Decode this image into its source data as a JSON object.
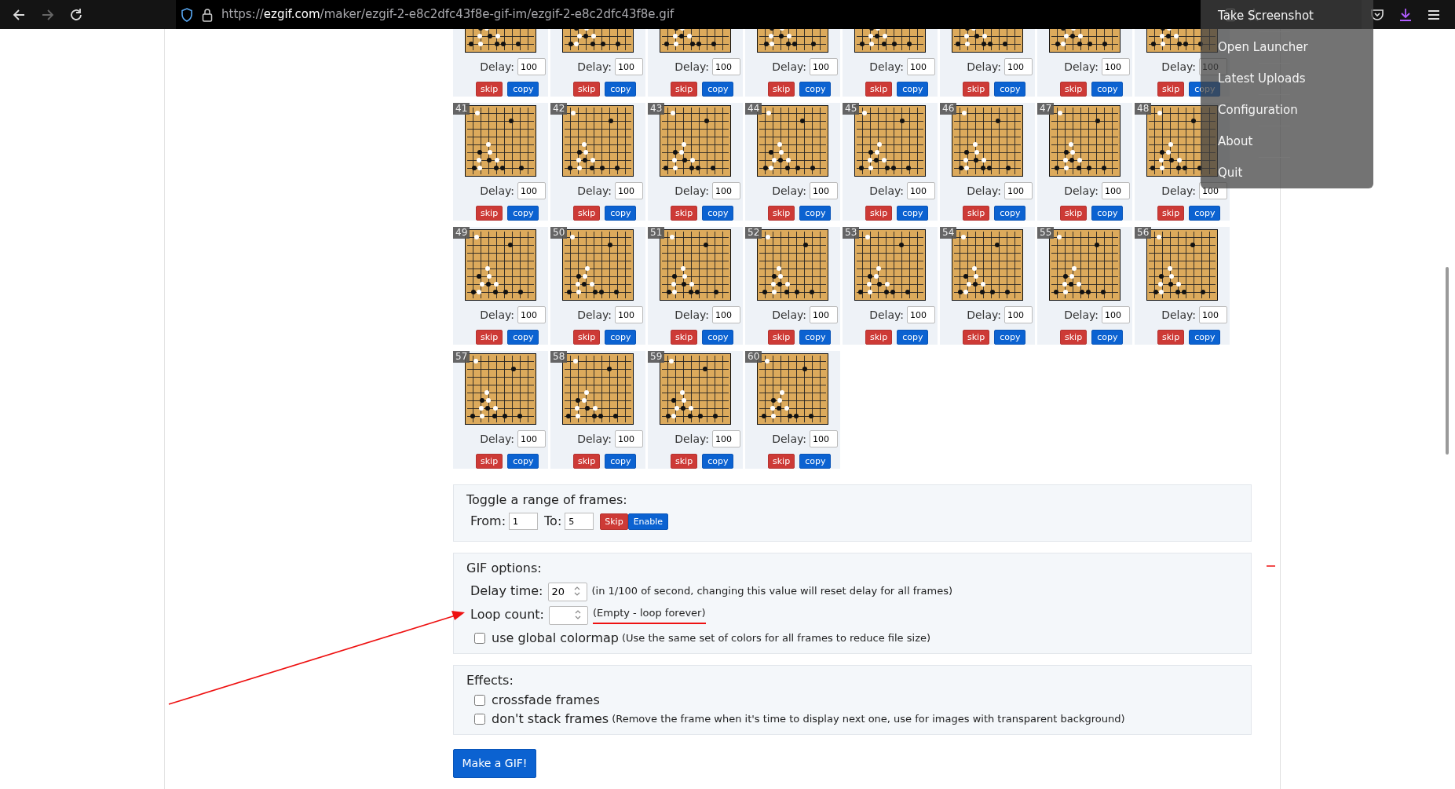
{
  "browser": {
    "url": "https://**ezgif.com**/maker/ezgif-2-e8c2dfc43f8e-gif-im/ezgif-2-e8c2dfc43f8e.gif"
  },
  "menu": {
    "items": [
      "Take Screenshot",
      "Open Launcher",
      "Latest Uploads",
      "Configuration",
      "About",
      "Quit"
    ]
  },
  "frames": [
    {
      "delay_label": "Delay:",
      "delay": "100",
      "skip": "skip",
      "copy": "copy"
    },
    {
      "delay_label": "Delay:",
      "delay": "100",
      "skip": "skip",
      "copy": "copy"
    },
    {
      "delay_label": "Delay:",
      "delay": "100",
      "skip": "skip",
      "copy": "copy"
    },
    {
      "delay_label": "Delay:",
      "delay": "100",
      "skip": "skip",
      "copy": "copy"
    },
    {
      "delay_label": "Delay:",
      "delay": "100",
      "skip": "skip",
      "copy": "copy"
    },
    {
      "delay_label": "Delay:",
      "delay": "100",
      "skip": "skip",
      "copy": "copy"
    },
    {
      "delay_label": "Delay:",
      "delay": "100",
      "skip": "skip",
      "copy": "copy"
    },
    {
      "delay_label": "Delay:",
      "delay": "100",
      "skip": "skip",
      "copy": "copy"
    },
    {
      "label": "41",
      "delay_label": "Delay:",
      "delay": "100",
      "skip": "skip",
      "copy": "copy"
    },
    {
      "label": "42",
      "delay_label": "Delay:",
      "delay": "100",
      "skip": "skip",
      "copy": "copy"
    },
    {
      "label": "43",
      "delay_label": "Delay:",
      "delay": "100",
      "skip": "skip",
      "copy": "copy"
    },
    {
      "label": "44",
      "delay_label": "Delay:",
      "delay": "100",
      "skip": "skip",
      "copy": "copy"
    },
    {
      "label": "45",
      "delay_label": "Delay:",
      "delay": "100",
      "skip": "skip",
      "copy": "copy"
    },
    {
      "label": "46",
      "delay_label": "Delay:",
      "delay": "100",
      "skip": "skip",
      "copy": "copy"
    },
    {
      "label": "47",
      "delay_label": "Delay:",
      "delay": "100",
      "skip": "skip",
      "copy": "copy"
    },
    {
      "label": "48",
      "delay_label": "Delay:",
      "delay": "100",
      "skip": "skip",
      "copy": "copy"
    },
    {
      "label": "49",
      "delay_label": "Delay:",
      "delay": "100",
      "skip": "skip",
      "copy": "copy"
    },
    {
      "label": "50",
      "delay_label": "Delay:",
      "delay": "100",
      "skip": "skip",
      "copy": "copy"
    },
    {
      "label": "51",
      "delay_label": "Delay:",
      "delay": "100",
      "skip": "skip",
      "copy": "copy"
    },
    {
      "label": "52",
      "delay_label": "Delay:",
      "delay": "100",
      "skip": "skip",
      "copy": "copy"
    },
    {
      "label": "53",
      "delay_label": "Delay:",
      "delay": "100",
      "skip": "skip",
      "copy": "copy"
    },
    {
      "label": "54",
      "delay_label": "Delay:",
      "delay": "100",
      "skip": "skip",
      "copy": "copy"
    },
    {
      "label": "55",
      "delay_label": "Delay:",
      "delay": "100",
      "skip": "skip",
      "copy": "copy"
    },
    {
      "label": "56",
      "delay_label": "Delay:",
      "delay": "100",
      "skip": "skip",
      "copy": "copy"
    },
    {
      "label": "57",
      "delay_label": "Delay:",
      "delay": "100",
      "skip": "skip",
      "copy": "copy"
    },
    {
      "label": "58",
      "delay_label": "Delay:",
      "delay": "100",
      "skip": "skip",
      "copy": "copy"
    },
    {
      "label": "59",
      "delay_label": "Delay:",
      "delay": "100",
      "skip": "skip",
      "copy": "copy"
    },
    {
      "label": "60",
      "delay_label": "Delay:",
      "delay": "100",
      "skip": "skip",
      "copy": "copy"
    }
  ],
  "toggle_range": {
    "title": "Toggle a range of frames:",
    "from_label": "From:",
    "from": "1",
    "to_label": "To:",
    "to": "5",
    "skip": "Skip",
    "enable": "Enable"
  },
  "gif_options": {
    "title": "GIF options:",
    "delay_label": "Delay time:",
    "delay": "20",
    "delay_hint": "(in 1/100 of second, changing this value will reset delay for all frames)",
    "loop_label": "Loop count:",
    "loop_hint": "(Empty - loop forever)",
    "colormap": {
      "label": "use global colormap",
      "hint": "(Use the same set of colors for all frames to reduce file size)",
      "checked": false
    }
  },
  "effects": {
    "title": "Effects:",
    "options": [
      {
        "label": "crossfade frames",
        "checked": false
      },
      {
        "label": "don't stack frames",
        "hint": "(Remove the frame when it's time to display next one, use for images with transparent background)",
        "checked": false
      }
    ]
  },
  "submit": "Make a GIF!"
}
